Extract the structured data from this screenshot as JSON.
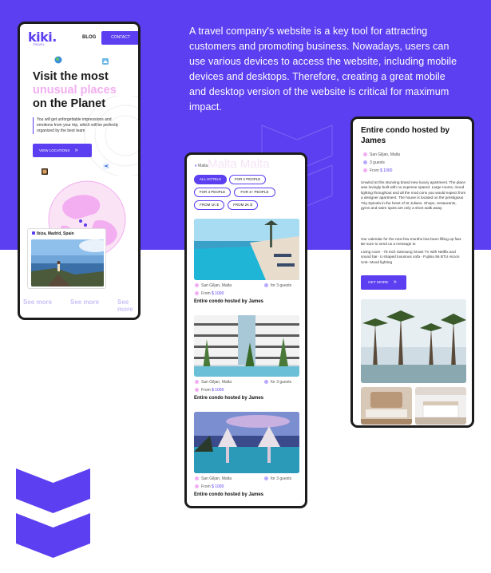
{
  "intro": {
    "text": "A travel company's website is a key tool for attracting customers and promoting business. Nowadays, users can use various devices to access the website, including mobile devices and desktops. Therefore, creating a great mobile and desktop version of the website is critical for maximum impact."
  },
  "brand": {
    "accent": "#5b3ff0",
    "pink": "#f2aef0"
  },
  "phone1": {
    "logo": "kiki.",
    "logo_sub": "TRAVEL",
    "nav_blog": "BLOG",
    "nav_contact": "CONTACT",
    "hero_line1": "Visit the most",
    "hero_line2": "unusual places",
    "hero_line3": "on the Planet",
    "hero_desc": "You will get unforgettable impressions and emotions from your trip, which will be perfectly organized by the best team",
    "cta": "VIEW LOCATIONS",
    "location_label": "Ibiza, Madrid, Spain",
    "see_more": "See more"
  },
  "phone2": {
    "back_label": "Malta",
    "watermark": "Malta   Malta",
    "filters": [
      "ALL HOTELS",
      "FOR 2 PEOPLE",
      "FOR 3 PEOPLE",
      "FOR 4+ PEOPLE",
      "FROM 1K $",
      "FROM 2K $"
    ],
    "hotels": [
      {
        "location": "San Giljan, Malta",
        "guests": "for 3 guests",
        "price_prefix": "From",
        "price": "$ 1000",
        "name": "Entire condo hosted by James"
      },
      {
        "location": "San Giljan, Malta",
        "guests": "for 3 guests",
        "price_prefix": "From",
        "price": "$ 1000",
        "name": "Entire condo hosted by James"
      },
      {
        "location": "San Giljan, Malta",
        "guests": "for 3 guests",
        "price_prefix": "From",
        "price": "$ 1000",
        "name": "Entire condo hosted by James"
      }
    ]
  },
  "phone3": {
    "title": "Entire condo hosted by James",
    "location": "San Giljan, Malta",
    "guests": "3 guests",
    "price_prefix": "From",
    "price": "$ 1000",
    "para1": "Unwind at this stunning brand new luxury apartment. The place was lovingly built with no expense spared. Large rooms, mood lighting throughout and all the mod cons you would expect from a designer apartment. The house is located on the prestigious Triq Spinola in the heart of St Julians. Shops, restaurants, gyms and swim spots are only a short walk away.",
    "para2": "Our calendar for the next few months has been filling up fast. Be sure to send us a message to",
    "para3": "Living room - 75 inch Samsung Smart TV with Netflix and sound bar- U shaped luxurious sofa - Fujitsu 56 BTU Aircon Unit- Mood lighting",
    "cta": "GET MORE"
  }
}
